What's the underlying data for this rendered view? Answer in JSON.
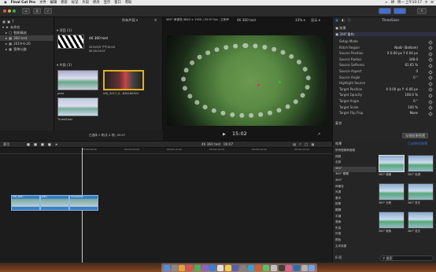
{
  "menubar": {
    "apple": "",
    "app": "Final Cut Pro",
    "items": [
      "文件",
      "编辑",
      "修剪",
      "标记",
      "片段",
      "修改",
      "显示",
      "窗口",
      "帮助"
    ],
    "input_method": "拼",
    "clock": "周一 上午10:17"
  },
  "libraries": {
    "root": "未命名",
    "items": [
      "智能精选",
      "360 test",
      "2019-6-26",
      "宽带公路"
    ]
  },
  "browser": {
    "filter": "所有片段",
    "section_project": "项目",
    "project_count": "(1)",
    "project_name": "4K 360 test",
    "project_meta": [
      "2019/2/5 下午10:04",
      "00:00:13:07"
    ],
    "section_events": "片段",
    "event_count": "(3)",
    "clips": [
      "pizio",
      "VID_2017_0...626160922",
      "ThreeSixer"
    ],
    "status": "已选择 1 项(共 4 项), 00:07"
  },
  "viewer": {
    "format": "360° 单视场 3840 × 1920 / 29.97 fps , 立体声",
    "title": "4K 360 test",
    "zoom": "33%",
    "view": "显示",
    "timecode": "15:02"
  },
  "inspector": {
    "clip": "ThreeSixer",
    "section": "效果",
    "effect": "360°重构",
    "rows": [
      {
        "label": "Setup Mode",
        "value": ""
      },
      {
        "label": "Patch Region",
        "value": "Nadir (Bottom)"
      },
      {
        "label": "Source Position",
        "value": "X 0.00 px  Y 0.04 px"
      },
      {
        "label": "Source Radius",
        "value": "348.0"
      },
      {
        "label": "Source Softness",
        "value": "61.65 %"
      },
      {
        "label": "Source Aspect",
        "value": "0"
      },
      {
        "label": "Source Angle",
        "value": "0 °"
      },
      {
        "label": "Highlight Source",
        "value": ""
      },
      {
        "label": "Target Position",
        "value": "X 0.00 px  Y -0.06 px"
      },
      {
        "label": "Target Opacity",
        "value": "100.0 %"
      },
      {
        "label": "Target Angle",
        "value": "0 °"
      },
      {
        "label": "Target Scale",
        "value": "100 %"
      },
      {
        "label": "Target Flip Flop",
        "value": "None"
      }
    ],
    "footer": "复合",
    "save_btn": "存储效果预置"
  },
  "timeline": {
    "index": "索引",
    "project": "4K 360 test",
    "duration": "00:07",
    "ruler": [
      "00:00:00:00",
      "00:00:05:00",
      "00:00:10:00",
      "00:00:15:00",
      "00:00:20:00",
      "00:00:25:00",
      "00:00:30:00",
      "00:00:35:00"
    ],
    "clips": [
      "VID_201...",
      "pizio",
      "ThreeSixer"
    ]
  },
  "effects": {
    "title": "效果",
    "installed": "已安装的效果",
    "categories": [
      "所有视频和音频",
      "视频",
      "全部",
      "360°",
      "360° 模糊",
      "360°",
      "风格化",
      "光源",
      "基本",
      "抠像",
      "模糊",
      "平铺",
      "漫画",
      "失真",
      "外观",
      "颜色",
      "文本效果"
    ],
    "items": [
      "360° 模糊",
      "360° 色调",
      "360° 光晕",
      "360° 发光",
      "360° 暗角",
      "360° 发光"
    ],
    "count": "8 项",
    "search": "搜索"
  },
  "colors": {
    "accent": "#3e6fd6",
    "clip": "#3a7fc4",
    "bg": "#1e1e1e"
  }
}
